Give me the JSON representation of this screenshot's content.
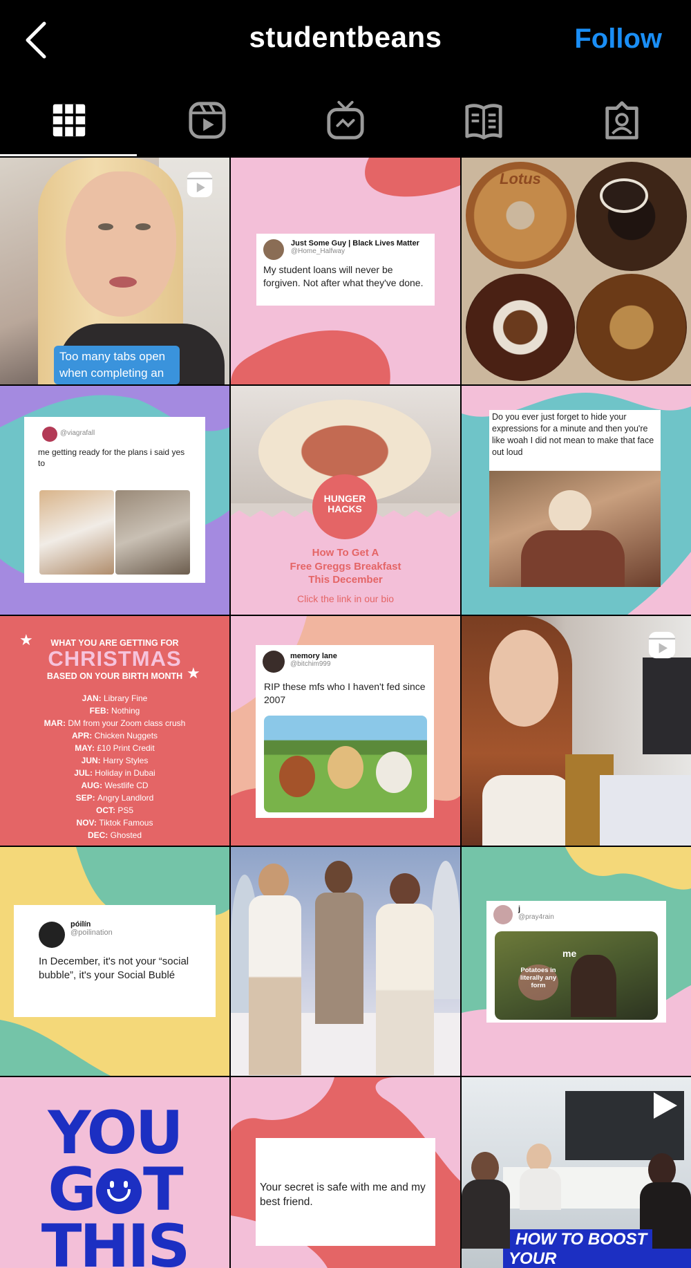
{
  "header": {
    "title": "studentbeans",
    "follow_label": "Follow"
  },
  "tabs": [
    {
      "name": "grid-icon"
    },
    {
      "name": "reels-icon"
    },
    {
      "name": "igtv-icon"
    },
    {
      "name": "guides-icon"
    },
    {
      "name": "tagged-icon"
    }
  ],
  "posts": {
    "p1": {
      "caption": "Too many tabs open when completing an"
    },
    "p2": {
      "user": "Just Some Guy | Black Lives Matter",
      "handle": "@Home_Halfway",
      "text": "My student loans will never be forgiven. Not after what they've done."
    },
    "p3": {
      "stamp": "Lotus"
    },
    "p4": {
      "handle": "@viagrafall",
      "text": "me getting ready for the plans i said yes to"
    },
    "p5": {
      "badge1": "HUNGER",
      "badge2": "HACKS",
      "line1": "How To Get A",
      "line2": "Free Greggs Breakfast",
      "line3": "This December",
      "cta": "Click the link in our bio"
    },
    "p6": {
      "text": "Do you ever just forget to hide your expressions for a minute and then you're like woah I did not mean to make that face out loud"
    },
    "p7": {
      "top": "WHAT YOU ARE GETTING FOR",
      "big": "CHRISTMAS",
      "sub": "BASED ON YOUR BIRTH MONTH",
      "months": [
        {
          "m": "JAN:",
          "v": "Library Fine"
        },
        {
          "m": "FEB:",
          "v": "Nothing"
        },
        {
          "m": "MAR:",
          "v": "DM from your Zoom class crush"
        },
        {
          "m": "APR:",
          "v": "Chicken Nuggets"
        },
        {
          "m": "MAY:",
          "v": "£10 Print Credit"
        },
        {
          "m": "JUN:",
          "v": "Harry Styles"
        },
        {
          "m": "JUL:",
          "v": "Holiday in Dubai"
        },
        {
          "m": "AUG:",
          "v": "Westlife CD"
        },
        {
          "m": "SEP:",
          "v": "Angry Landlord"
        },
        {
          "m": "OCT:",
          "v": "PS5"
        },
        {
          "m": "NOV:",
          "v": "Tiktok Famous"
        },
        {
          "m": "DEC:",
          "v": "Ghosted"
        }
      ]
    },
    "p8": {
      "user": "memory lane",
      "handle": "@bitchim999",
      "text": "RIP these mfs who I haven't fed since 2007"
    },
    "p10": {
      "user": "póilín",
      "handle": "@poilination",
      "text": "In December, it's not your “social bubble”, it's your Social Bublé"
    },
    "p12": {
      "user": "j",
      "handle": "@pray4rain",
      "label1": "me",
      "label2": "Potatoes in literally any form"
    },
    "p13": {
      "l1": "YOU",
      "l2a": "G",
      "l2b": "T",
      "l3": "THIS"
    },
    "p14": {
      "text": "Your secret is safe with me and my best friend."
    },
    "p15": {
      "l1": "HOW TO BOOST",
      "l2": "YOUR EMPLOYABILITY"
    }
  },
  "colors": {
    "follow": "#1a8ef5",
    "salmon": "#e46566",
    "pink": "#f3bfd8",
    "teal": "#6fc4c8",
    "purple": "#a48ae0",
    "navy": "#1c2fc2"
  }
}
